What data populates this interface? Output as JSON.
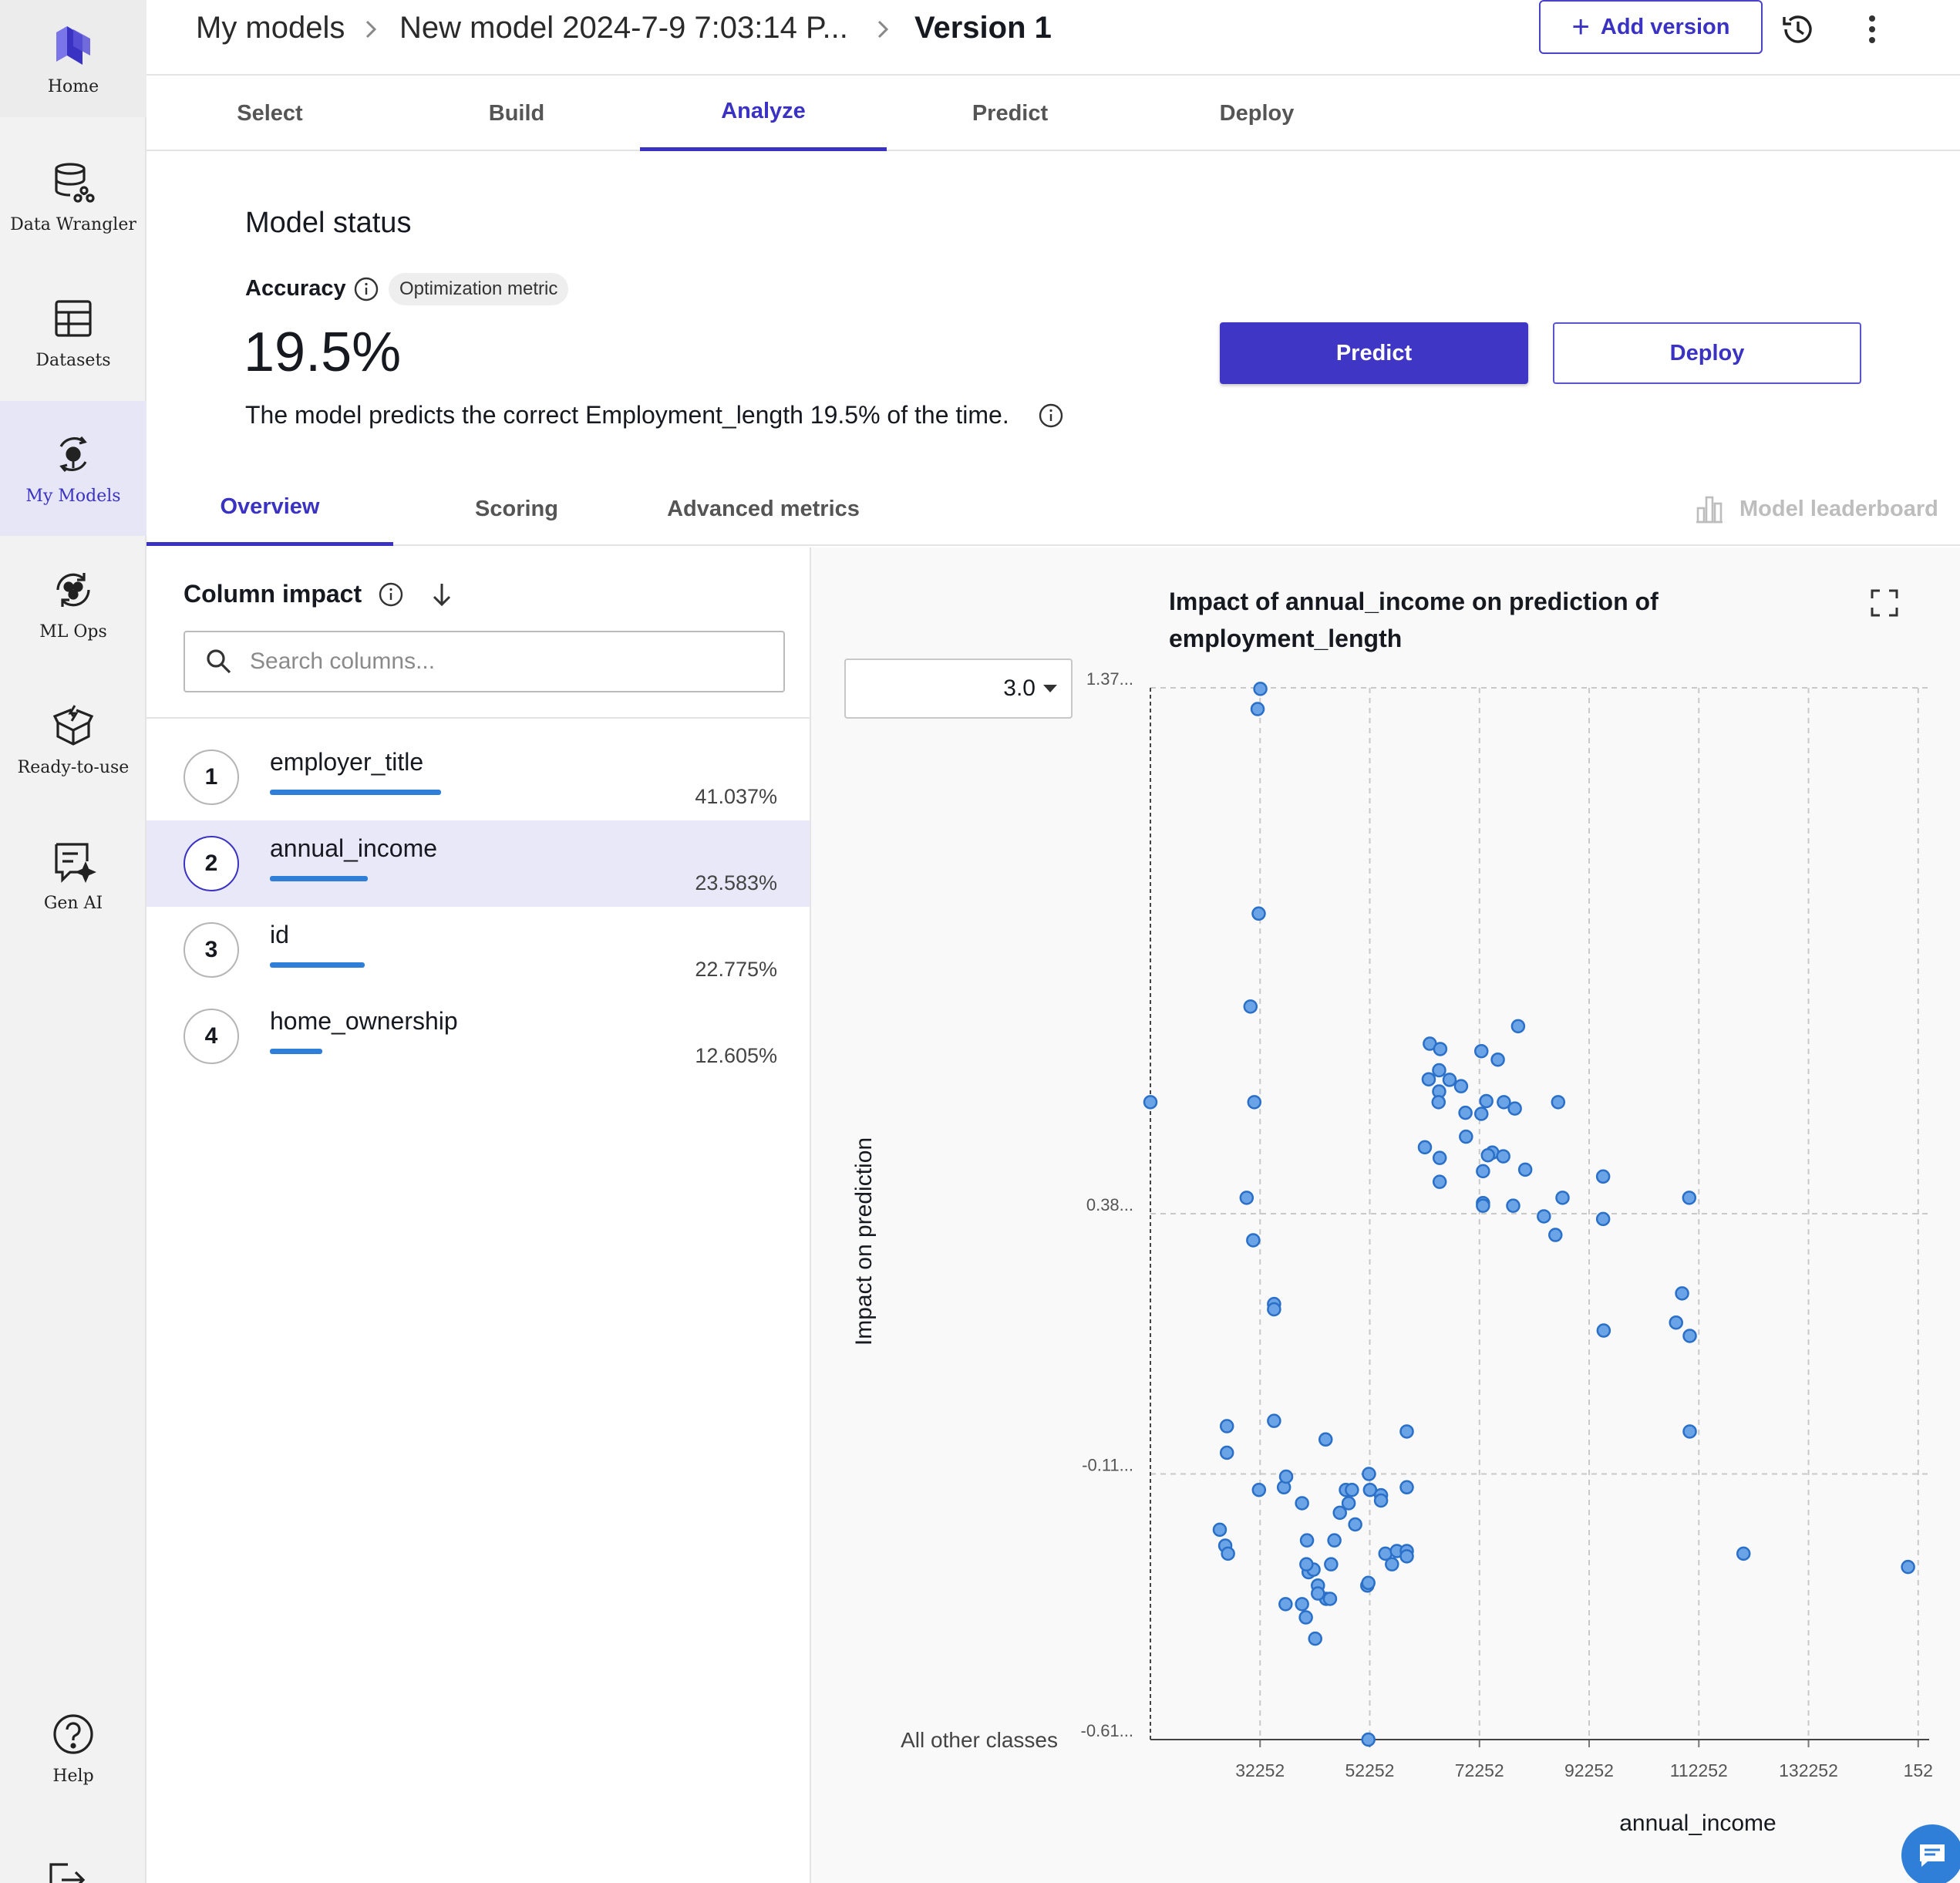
{
  "sidebar": {
    "items": [
      {
        "label": "Home",
        "icon": "home-logo-icon"
      },
      {
        "label": "Data Wrangler",
        "icon": "database-icon"
      },
      {
        "label": "Datasets",
        "icon": "table-icon"
      },
      {
        "label": "My Models",
        "icon": "models-icon",
        "active": true
      },
      {
        "label": "ML Ops",
        "icon": "ml-ops-icon"
      },
      {
        "label": "Ready-to-use",
        "icon": "box-icon"
      },
      {
        "label": "Gen AI",
        "icon": "chat-sparkle-icon"
      },
      {
        "label": "Help",
        "icon": "help-icon"
      }
    ]
  },
  "breadcrumb": {
    "root": "My models",
    "model": "New model 2024-7-9 7:03:14 P...",
    "version": "Version 1"
  },
  "header": {
    "add_version_label": "Add version"
  },
  "tabs": [
    "Select",
    "Build",
    "Analyze",
    "Predict",
    "Deploy"
  ],
  "active_tab": "Analyze",
  "model_status": {
    "title": "Model status",
    "metric_label": "Accuracy",
    "badge": "Optimization metric",
    "value": "19.5%",
    "description": "The model predicts the correct Employment_length 19.5% of the time.",
    "predict_label": "Predict",
    "deploy_label": "Deploy"
  },
  "subtabs": [
    "Overview",
    "Scoring",
    "Advanced metrics"
  ],
  "active_subtab": "Overview",
  "leaderboard_label": "Model leaderboard",
  "column_impact": {
    "title": "Column impact",
    "search_placeholder": "Search columns...",
    "columns": [
      {
        "rank": "1",
        "name": "employer_title",
        "pct": "41.037%",
        "value": 41.037
      },
      {
        "rank": "2",
        "name": "annual_income",
        "pct": "23.583%",
        "value": 23.583,
        "selected": true
      },
      {
        "rank": "3",
        "name": "id",
        "pct": "22.775%",
        "value": 22.775
      },
      {
        "rank": "4",
        "name": "home_ownership",
        "pct": "12.605%",
        "value": 12.605
      }
    ]
  },
  "chart_panel": {
    "title": "Impact of annual_income on prediction of employment_length",
    "class_value": "3.0",
    "other_classes_label": "All other classes"
  },
  "colors": {
    "accent": "#3f36c6",
    "bar": "#2f7fd8",
    "point_fill": "#6aa3e6",
    "point_stroke": "#2a6fc8"
  },
  "chart_data": {
    "type": "scatter",
    "xlabel": "annual_income",
    "ylabel": "Impact on prediction",
    "x_ticks": [
      {
        "label": "32252",
        "value": 32252
      },
      {
        "label": "52252",
        "value": 52252
      },
      {
        "label": "72252",
        "value": 72252
      },
      {
        "label": "92252",
        "value": 92252
      },
      {
        "label": "112252",
        "value": 112252
      },
      {
        "label": "132252",
        "value": 132252
      },
      {
        "label": "152",
        "value": 152252
      }
    ],
    "y_ticks": [
      {
        "label": "1.37...",
        "value": 1.37
      },
      {
        "label": "0.38...",
        "value": 0.38
      },
      {
        "label": "-0.11...",
        "value": -0.11
      },
      {
        "label": "-0.61...",
        "value": -0.61
      }
    ],
    "xlim": [
      12252,
      154252
    ],
    "ylim": [
      -0.61,
      1.37
    ],
    "grid": true,
    "points": [
      [
        12252,
        0.59
      ],
      [
        31800,
        1.33
      ],
      [
        32300,
        1.368
      ],
      [
        32000,
        0.945
      ],
      [
        30500,
        0.77
      ],
      [
        31200,
        0.59
      ],
      [
        29800,
        0.41
      ],
      [
        31000,
        0.33
      ],
      [
        34800,
        0.21
      ],
      [
        34800,
        0.2
      ],
      [
        34800,
        -0.01
      ],
      [
        26200,
        -0.02
      ],
      [
        26200,
        -0.07
      ],
      [
        32050,
        -0.14
      ],
      [
        36600,
        -0.135
      ],
      [
        37000,
        -0.115
      ],
      [
        44200,
        -0.045
      ],
      [
        36900,
        -0.355
      ],
      [
        39900,
        -0.165
      ],
      [
        40800,
        -0.235
      ],
      [
        41100,
        -0.295
      ],
      [
        40600,
        -0.38
      ],
      [
        42800,
        -0.32
      ],
      [
        42000,
        -0.29
      ],
      [
        44300,
        -0.345
      ],
      [
        42800,
        -0.335
      ],
      [
        42300,
        -0.42
      ],
      [
        45200,
        -0.28
      ],
      [
        45000,
        -0.345
      ],
      [
        46800,
        -0.183
      ],
      [
        45800,
        -0.235
      ],
      [
        47900,
        -0.14
      ],
      [
        48400,
        -0.165
      ],
      [
        49600,
        -0.205
      ],
      [
        49000,
        -0.14
      ],
      [
        52100,
        -0.11
      ],
      [
        52300,
        -0.14
      ],
      [
        51800,
        -0.32
      ],
      [
        52000,
        -0.315
      ],
      [
        54300,
        -0.15
      ],
      [
        54300,
        -0.16
      ],
      [
        55100,
        -0.26
      ],
      [
        56300,
        -0.28
      ],
      [
        57200,
        -0.255
      ],
      [
        59000,
        -0.03
      ],
      [
        59000,
        -0.135
      ],
      [
        59000,
        -0.255
      ],
      [
        59000,
        -0.265
      ],
      [
        24900,
        -0.215
      ],
      [
        25900,
        -0.245
      ],
      [
        26400,
        -0.26
      ],
      [
        40700,
        -0.28
      ],
      [
        39900,
        -0.355
      ],
      [
        52000,
        -0.61
      ],
      [
        63200,
        0.7
      ],
      [
        65100,
        0.69
      ],
      [
        64900,
        0.65
      ],
      [
        63000,
        0.633
      ],
      [
        64900,
        0.61
      ],
      [
        66800,
        0.632
      ],
      [
        64800,
        0.59
      ],
      [
        62300,
        0.505
      ],
      [
        65000,
        0.485
      ],
      [
        69700,
        0.57
      ],
      [
        69800,
        0.525
      ],
      [
        68900,
        0.62
      ],
      [
        73500,
        0.592
      ],
      [
        76700,
        0.59
      ],
      [
        72600,
        0.568
      ],
      [
        72600,
        0.686
      ],
      [
        74600,
        0.495
      ],
      [
        75600,
        0.67
      ],
      [
        65000,
        0.44
      ],
      [
        72900,
        0.46
      ],
      [
        73800,
        0.49
      ],
      [
        76600,
        0.488
      ],
      [
        79300,
        0.733
      ],
      [
        78700,
        0.578
      ],
      [
        80600,
        0.463
      ],
      [
        72900,
        0.4
      ],
      [
        72900,
        0.395
      ],
      [
        78400,
        0.395
      ],
      [
        84000,
        0.375
      ],
      [
        86600,
        0.59
      ],
      [
        86100,
        0.34
      ],
      [
        87400,
        0.41
      ],
      [
        94800,
        0.45
      ],
      [
        94800,
        0.37
      ],
      [
        110500,
        0.41
      ],
      [
        109200,
        0.23
      ],
      [
        108100,
        0.175
      ],
      [
        110600,
        0.15
      ],
      [
        110600,
        -0.03
      ],
      [
        94900,
        0.16
      ],
      [
        120400,
        -0.26
      ],
      [
        150400,
        -0.285
      ]
    ]
  }
}
